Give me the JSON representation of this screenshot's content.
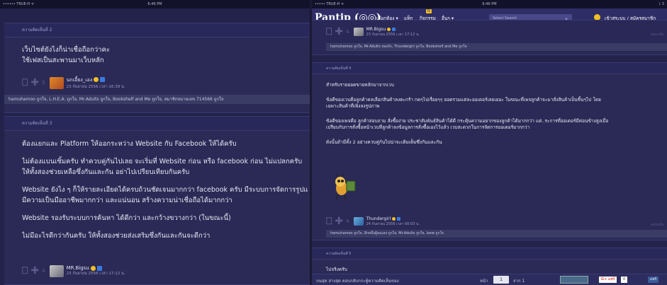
{
  "left": {
    "status_bar": {
      "carrier": "•••••• TRUE-H ᯤ",
      "time": "6:46 PM"
    },
    "post2": {
      "header": "ความคิดเห็นที่ 2",
      "lines": [
        "เว็บไซต์ยังไงก็น่าเชื่อถือกว่าคะ",
        "ใช้เฟสเป็นสะพานมาเว็บหลัก"
      ],
      "vote_count": "5",
      "username": "นกเอี้ยง_เอง",
      "date": "23 กันยายน 2556 เวลา 16:39 น.",
      "likes": "hamuhamoo ถูกใจ, L.H.E.A. ถูกใจ, Mr.Adults ถูกใจ, Bookshelf and Me ถูกใจ, สมาชิกหมายเลข 714566 ถูกใจ"
    },
    "post3": {
      "header": "ความคิดเห็นที่ 3",
      "paragraphs": [
        "ต้องแยกและ Platform ให้ออกระหว่าง Website กับ Facebook ให้ได้ครับ",
        "ไม่ต้องแบนเซิ้มครับ ทำควบคู่กันไปเลย จะเริ่มที่ Website ก่อน หรือ facebook ก่อน ไม่แปลกครับ",
        "ให้ทั้งสองช่วยเหลือซึ่งกันและกัน อย่าไปเปรียบเทียบกันครับ",
        "Website ยังไง ๆ ก็ให้รายละเอียดได้ครบถ้วนชัดเจนมากกว่า facebook ครับ มีระบบการจัดการรูปแบบได้ดี",
        "มีความเป็นมืออาชีพมากกว่า และแน่นอน สร้างความน่าเชื่อถือได้มากกว่า",
        "Website รองรับระบบการค้นหา ได้ดีกว่า และกว้างขวางกว่า (ในขณะนี้)",
        "ไม่มีอะไรดีกว่ากันครับ ให้ทั้งสองช่วยส่งเสริมซึ่งกันและกันจะดีกว่า"
      ],
      "vote_count": "4",
      "username": "MR.Bigsu",
      "date": "23 กันยายน 2556 เวลา 17:12 น."
    }
  },
  "right": {
    "status_bar": {
      "carrier": "••••• TRUE-H ᯤ",
      "time": "6:46 PM",
      "battery": "ᛒ 3"
    },
    "nav": {
      "logo": "Pantip (◎◎)",
      "items": [
        "เลือกห้อง ▾",
        "แท็ก",
        "กิจกรรม",
        "อื่นๆ ▾"
      ],
      "badge": "N",
      "search_placeholder": "Select Search",
      "login": "เข้าสู่ระบบ / สมัครสมาชิก"
    },
    "post_top": {
      "vote_count": "4",
      "username": "MR.Bigsu",
      "date": "23 กันยายน 2556 เวลา 17:12 น.",
      "reply": "ตอบกลับ",
      "likes": "hamuhamoo ถูกใจ, Mr.Adults หลงรัก, Thundergirl ถูกใจ, Bookshelf and Me ถูกใจ"
    },
    "post4": {
      "header": "ความคิดเห็นที่ 4",
      "paragraphs": [
        "สำหรับรายยอดขายหลักมาจากเวบ",
        "ข้อดีของเวบคือลูกค้าคลเลือกสินค้าลงตะกร้า กดๆไปเรื่อยๆๆ ยอดรวมแต่ละออเดอร์เลยเยอะ ในขณะที่เพจลูกค้าจะมาสั่งสินค้าเป็นชิ้นๆไป โดย",
        "เฉพาะสินค้าที่เพิ่งลงรูปภาพ",
        "ข้อดีของเพจคือ ลูกค้าสอบถาม สั่งซื้อง่าย ประชาสัมพันธ์สินค้าได้ดี กระตุ้นความอยากของลูกค้าได้มากกว่า แต่..ระการที่ออเดอร์มีค่อนข้างสูงเมื่อ",
        "เปรียบกับการสั่งซื้อหน้าเวบที่ลูกค้าลงข้อมูลการสั่งซื้อเองไว้แล้ว เวบสะดวกในการจัดการออเดอร์มากกว่า",
        "ดังนั้นถ้ามีทั้ง 2 อย่างควบคู่กันไปน่าจะเติมเต็มซึ่งกันและกัน"
      ],
      "vote_count": "4",
      "username": "Thundergirl",
      "date": "24 กันยายน 2556 เวลา 00:03 น.",
      "reply": "ตอบกลับ",
      "likes": "hamuhamoo ถูกใจ, อีกหนึ่งผู้ลงแลง ถูกใจ, Mr.Adults ถูกใจ, Isew ถูกใจ"
    },
    "post5": {
      "header": "ความคิดเห็นที่ 5",
      "line": "ไปจริงครับ"
    },
    "footer": {
      "left": "บนสุด  ล่างสุด  ตอบกลับกระทู้ความคิดเห็นของ",
      "page_label": "หน้า",
      "page_value": "1",
      "page_total": "จาก 1",
      "gplus": "G+ แชร์",
      "gplus_count": "0",
      "fb": "แชร์"
    }
  }
}
